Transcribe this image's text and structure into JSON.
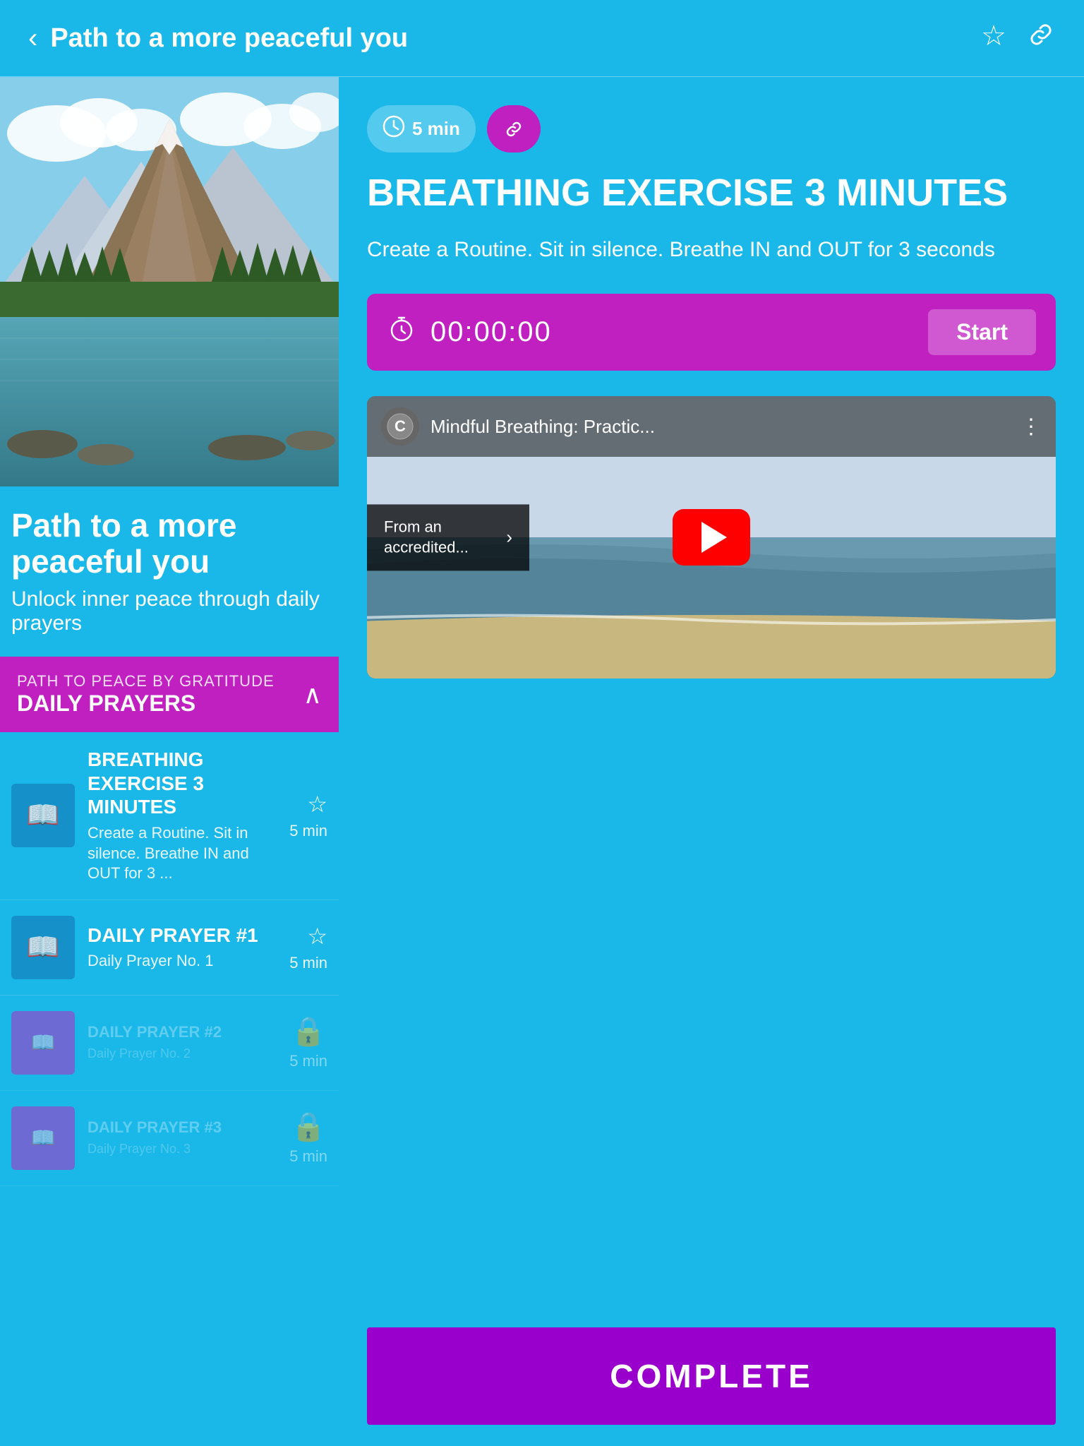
{
  "header": {
    "title": "Path to a more peaceful you",
    "back_label": "‹",
    "fav_icon": "☆",
    "link_icon": "⚇"
  },
  "hero": {
    "course_title": "Path to a more peaceful you",
    "course_subtitle": "Unlock inner peace through daily prayers"
  },
  "section": {
    "tag": "PATH TO PEACE BY GRATITUDE",
    "name": "DAILY PRAYERS"
  },
  "lesson_active": {
    "duration_badge": "5 min",
    "link_badge": "🔗",
    "title": "BREATHING EXERCISE 3 MINUTES",
    "description": "Create a Routine. Sit in silence. Breathe IN and OUT for 3 seconds",
    "timer": "00:00:00",
    "start_label": "Start",
    "video_title": "Mindful Breathing: Practic...",
    "accredited_text": "From an accredited...",
    "complete_label": "COMPLETE"
  },
  "lessons": [
    {
      "id": 1,
      "title": "BREATHING EXERCISE 3 MINUTES",
      "description": "Create a Routine. Sit in silence. Breathe IN and OUT for 3 ...",
      "duration": "5 min",
      "locked": false,
      "active": true
    },
    {
      "id": 2,
      "title": "DAILY PRAYER #1",
      "description": "Daily Prayer No. 1",
      "duration": "5 min",
      "locked": false,
      "active": false
    },
    {
      "id": 3,
      "title": "DAILY PRAYER #2",
      "description": "Daily Prayer No. 2",
      "duration": "5 min",
      "locked": true,
      "active": false
    },
    {
      "id": 4,
      "title": "DAILY PRAYER #3",
      "description": "Daily Prayer No. 3",
      "duration": "5 min",
      "locked": true,
      "active": false
    }
  ]
}
